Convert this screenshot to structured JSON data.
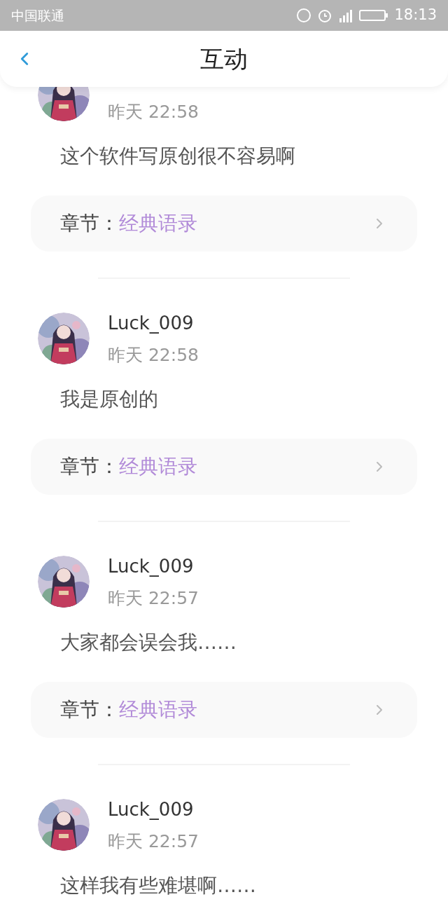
{
  "status_bar": {
    "carrier": "中国联通",
    "time": "18:13"
  },
  "header": {
    "title": "互动"
  },
  "comments": [
    {
      "time": "昨天 22:58",
      "text": "这个软件写原创很不容易啊",
      "chapter_label": "章节：",
      "chapter": "经典语录"
    },
    {
      "user": "Luck_009",
      "time": "昨天 22:58",
      "text": "我是原创的",
      "chapter_label": "章节：",
      "chapter": "经典语录"
    },
    {
      "user": "Luck_009",
      "time": "昨天 22:57",
      "text": "大家都会误会我……",
      "chapter_label": "章节：",
      "chapter": "经典语录"
    },
    {
      "user": "Luck_009",
      "time": "昨天 22:57",
      "text": "这样我有些难堪啊……"
    }
  ]
}
